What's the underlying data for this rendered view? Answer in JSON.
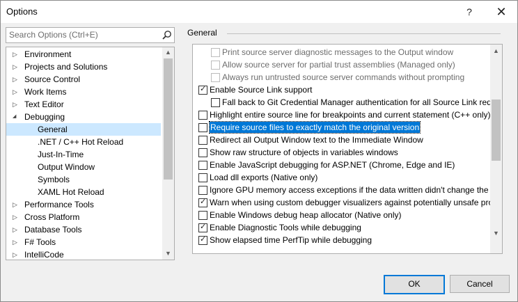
{
  "window": {
    "title": "Options",
    "help_glyph": "?",
    "close_glyph": "✕"
  },
  "search": {
    "placeholder": "Search Options (Ctrl+E)",
    "value": ""
  },
  "tree": {
    "items": [
      {
        "label": "Environment",
        "expander": "▷",
        "level": 0,
        "selected": false
      },
      {
        "label": "Projects and Solutions",
        "expander": "▷",
        "level": 0,
        "selected": false
      },
      {
        "label": "Source Control",
        "expander": "▷",
        "level": 0,
        "selected": false
      },
      {
        "label": "Work Items",
        "expander": "▷",
        "level": 0,
        "selected": false
      },
      {
        "label": "Text Editor",
        "expander": "▷",
        "level": 0,
        "selected": false
      },
      {
        "label": "Debugging",
        "expander": "◢",
        "level": 0,
        "selected": false
      },
      {
        "label": "General",
        "expander": "",
        "level": 1,
        "selected": true
      },
      {
        "label": ".NET / C++ Hot Reload",
        "expander": "",
        "level": 1,
        "selected": false
      },
      {
        "label": "Just-In-Time",
        "expander": "",
        "level": 1,
        "selected": false
      },
      {
        "label": "Output Window",
        "expander": "",
        "level": 1,
        "selected": false
      },
      {
        "label": "Symbols",
        "expander": "",
        "level": 1,
        "selected": false
      },
      {
        "label": "XAML Hot Reload",
        "expander": "",
        "level": 1,
        "selected": false
      },
      {
        "label": "Performance Tools",
        "expander": "▷",
        "level": 0,
        "selected": false
      },
      {
        "label": "Cross Platform",
        "expander": "▷",
        "level": 0,
        "selected": false
      },
      {
        "label": "Database Tools",
        "expander": "▷",
        "level": 0,
        "selected": false
      },
      {
        "label": "F# Tools",
        "expander": "▷",
        "level": 0,
        "selected": false
      },
      {
        "label": "IntelliCode",
        "expander": "▷",
        "level": 0,
        "selected": false
      }
    ],
    "scroll_position": 0.0
  },
  "general": {
    "title": "General",
    "options": [
      {
        "label": "Print source server diagnostic messages to the Output window",
        "checked": false,
        "enabled": false,
        "indent": 1,
        "highlight": false
      },
      {
        "label": "Allow source server for partial trust assemblies (Managed only)",
        "checked": false,
        "enabled": false,
        "indent": 1,
        "highlight": false
      },
      {
        "label": "Always run untrusted source server commands without prompting",
        "checked": false,
        "enabled": false,
        "indent": 1,
        "highlight": false
      },
      {
        "label": "Enable Source Link support",
        "checked": true,
        "enabled": true,
        "indent": 0,
        "highlight": false
      },
      {
        "label": "Fall back to Git Credential Manager authentication for all Source Link requ",
        "checked": false,
        "enabled": true,
        "indent": 1,
        "highlight": false
      },
      {
        "label": "Highlight entire source line for breakpoints and current statement (C++ only)",
        "checked": false,
        "enabled": true,
        "indent": 0,
        "highlight": false
      },
      {
        "label": "Require source files to exactly match the original version",
        "checked": false,
        "enabled": true,
        "indent": 0,
        "highlight": true
      },
      {
        "label": "Redirect all Output Window text to the Immediate Window",
        "checked": false,
        "enabled": true,
        "indent": 0,
        "highlight": false
      },
      {
        "label": "Show raw structure of objects in variables windows",
        "checked": false,
        "enabled": true,
        "indent": 0,
        "highlight": false
      },
      {
        "label": "Enable JavaScript debugging for ASP.NET (Chrome, Edge and IE)",
        "checked": false,
        "enabled": true,
        "indent": 0,
        "highlight": false
      },
      {
        "label": "Load dll exports (Native only)",
        "checked": false,
        "enabled": true,
        "indent": 0,
        "highlight": false
      },
      {
        "label": "Ignore GPU memory access exceptions if the data written didn't change the v",
        "checked": false,
        "enabled": true,
        "indent": 0,
        "highlight": false
      },
      {
        "label": "Warn when using custom debugger visualizers against potentially unsafe pro",
        "checked": true,
        "enabled": true,
        "indent": 0,
        "highlight": false
      },
      {
        "label": "Enable Windows debug heap allocator (Native only)",
        "checked": false,
        "enabled": true,
        "indent": 0,
        "highlight": false
      },
      {
        "label": "Enable Diagnostic Tools while debugging",
        "checked": true,
        "enabled": true,
        "indent": 0,
        "highlight": false
      },
      {
        "label": "Show elapsed time PerfTip while debugging",
        "checked": true,
        "enabled": true,
        "indent": 0,
        "highlight": false
      }
    ],
    "scroll_position": 0.4
  },
  "buttons": {
    "ok": "OK",
    "cancel": "Cancel"
  },
  "icons": {
    "search": "search-icon",
    "scroll_up": "▲",
    "scroll_down": "▼",
    "check": "✓"
  },
  "colors": {
    "selection": "#cce8ff",
    "highlight": "#0078d7",
    "default_button_border": "#0078d7"
  }
}
